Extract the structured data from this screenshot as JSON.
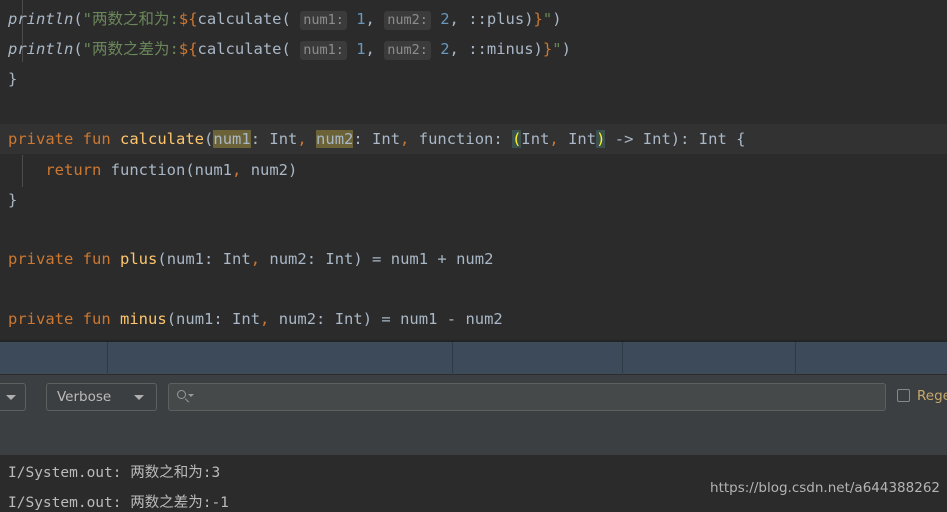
{
  "editor": {
    "lines": [
      {
        "id": "line-println-sum",
        "indent_guide": true,
        "text": "    println(\"两数之和为:${calculate( num1: 1, num2: 2, ::plus)}\")"
      },
      {
        "id": "line-println-diff",
        "indent_guide": true,
        "text": "    println(\"两数之差为:${calculate( num1: 1, num2: 2, ::minus)}\")"
      },
      {
        "id": "line-close-brace-1",
        "text": "}"
      },
      {
        "id": "line-blank-1",
        "text": ""
      },
      {
        "id": "line-calculate-sig",
        "current": true,
        "text": "private fun calculate(num1: Int, num2: Int, function: (Int, Int) -> Int): Int {"
      },
      {
        "id": "line-return",
        "indent_guide": true,
        "text": "    return function(num1, num2)"
      },
      {
        "id": "line-close-brace-2",
        "text": "}"
      },
      {
        "id": "line-blank-2",
        "text": ""
      },
      {
        "id": "line-plus",
        "text": "private fun plus(num1: Int, num2: Int) = num1 + num2"
      },
      {
        "id": "line-blank-3",
        "text": ""
      },
      {
        "id": "line-minus",
        "text": "private fun minus(num1: Int, num2: Int) = num1 - num2"
      }
    ],
    "tokens": {
      "kw_private": "private",
      "kw_fun": "fun",
      "kw_return": "return",
      "fn_println": "println",
      "fn_calculate": "calculate",
      "fn_plus": "plus",
      "fn_minus": "minus",
      "str_sum": "两数之和为:",
      "str_diff": "两数之差为:",
      "hint_num1": "num1:",
      "hint_num2": "num2:",
      "num_1": "1",
      "num_2": "2",
      "ref_plus": "::plus",
      "ref_minus": "::minus",
      "type_int": "Int",
      "param_function": "function",
      "arrow": "->",
      "ident_num1": "num1",
      "ident_num2": "num2",
      "ident_function": "function",
      "op_plus": "+",
      "op_minus": "-",
      "op_eq": "="
    }
  },
  "toolbar": {
    "left_dropdown_label": "",
    "level_dropdown_label": "Verbose",
    "search_value": "",
    "search_placeholder": "",
    "regex_label": "Regex",
    "regex_checked": false
  },
  "console": {
    "lines": [
      {
        "tag": "I/System.out: ",
        "message": "两数之和为:3"
      },
      {
        "tag": "I/System.out: ",
        "message": "两数之差为:-1"
      }
    ]
  },
  "watermark": {
    "text": "https://blog.csdn.net/a644388262"
  },
  "colors": {
    "editor_bg": "#2b2b2b",
    "panel_bg": "#3c3f41",
    "strip_bg": "#3c4a5a",
    "keyword": "#cc7832",
    "function_name": "#ffc66d",
    "string": "#6a8759",
    "number": "#6897bb",
    "default_text": "#a9b7c6",
    "hint_bg": "#3b3b3b",
    "occurrence_bg": "#6b6238",
    "brace_match_bg": "#3b514d",
    "brace_match_fg": "#ffef28",
    "regex_label": "#c8a96a"
  }
}
